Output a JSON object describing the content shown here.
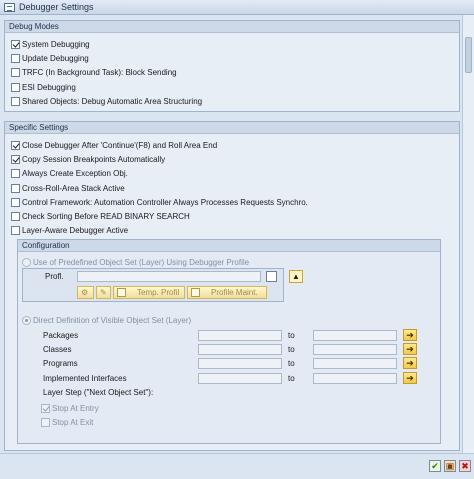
{
  "window": {
    "title": "Debugger Settings"
  },
  "debug_modes": {
    "title": "Debug Modes",
    "options": [
      {
        "label": "System Debugging",
        "checked": true
      },
      {
        "label": "Update Debugging",
        "checked": false
      },
      {
        "label": "TRFC (In Background Task): Block Sending",
        "checked": false
      },
      {
        "label": "ESI Debugging",
        "checked": false
      },
      {
        "label": "Shared Objects: Debug Automatic Area Structuring",
        "checked": false
      }
    ]
  },
  "specific_settings": {
    "title": "Specific Settings",
    "options": [
      {
        "label": "Close Debugger After 'Continue'(F8) and Roll Area End",
        "checked": true
      },
      {
        "label": "Copy Session Breakpoints Automatically",
        "checked": true
      },
      {
        "label": "Always Create Exception Obj.",
        "checked": false
      },
      {
        "label": "Cross-Roll-Area Stack Active",
        "checked": false
      },
      {
        "label": "Control Framework: Automation Controller Always Processes Requests Synchro.",
        "checked": false
      },
      {
        "label": "Check Sorting Before READ BINARY SEARCH",
        "checked": false
      },
      {
        "label": "Layer-Aware Debugger Active",
        "checked": false
      }
    ]
  },
  "configuration": {
    "title": "Configuration",
    "predefined_radio": "Use of Predefined Object Set (Layer) Using Debugger Profile",
    "profil_label": "Profl.",
    "profil_value": "",
    "temp_profil_button": "Temp. Profil",
    "profile_maint_button": "Profile Maint.",
    "direct_radio": "Direct Definition of Visible Object Set (Layer)",
    "to_label": "to",
    "rows": [
      {
        "label": "Packages",
        "from": "",
        "to": ""
      },
      {
        "label": "Classes",
        "from": "",
        "to": ""
      },
      {
        "label": "Programs",
        "from": "",
        "to": ""
      },
      {
        "label": "Implemented Interfaces",
        "from": "",
        "to": ""
      }
    ],
    "layer_step_label": "Layer Step (\"Next Object Set\"):",
    "stop_at_entry": {
      "label": "Stop At Entry",
      "checked": true
    },
    "stop_at_exit": {
      "label": "Stop At Exit",
      "checked": false
    }
  },
  "icons": {
    "title": "window-icon",
    "arrow": "arrow-right-icon",
    "confirm": "check-icon",
    "save": "save-icon",
    "cancel": "close-icon"
  }
}
